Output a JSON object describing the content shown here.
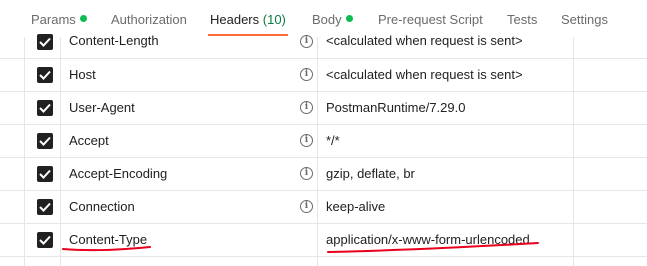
{
  "tabs": [
    {
      "label": "Params",
      "dot": true
    },
    {
      "label": "Authorization"
    },
    {
      "label": "Headers",
      "count": "(10)",
      "active": true
    },
    {
      "label": "Body",
      "dot": true
    },
    {
      "label": "Pre-request Script"
    },
    {
      "label": "Tests"
    },
    {
      "label": "Settings"
    }
  ],
  "headers": [
    {
      "key": "Content-Length",
      "value": "<calculated when request is sent>",
      "checked": true,
      "info_icon": true
    },
    {
      "key": "Host",
      "value": "<calculated when request is sent>",
      "checked": true,
      "info_icon": true
    },
    {
      "key": "User-Agent",
      "value": "PostmanRuntime/7.29.0",
      "checked": true,
      "info_icon": true
    },
    {
      "key": "Accept",
      "value": "*/*",
      "checked": true,
      "info_icon": true
    },
    {
      "key": "Accept-Encoding",
      "value": "gzip, deflate, br",
      "checked": true,
      "info_icon": true
    },
    {
      "key": "Connection",
      "value": "keep-alive",
      "checked": true,
      "info_icon": true
    },
    {
      "key": "Content-Type",
      "value": "application/x-www-form-urlencoded",
      "checked": true,
      "info_icon": false
    }
  ],
  "colors": {
    "active_tab_underline": "#ff6c37",
    "status_dot": "#0cbb52",
    "annotation": "#e8001c"
  }
}
